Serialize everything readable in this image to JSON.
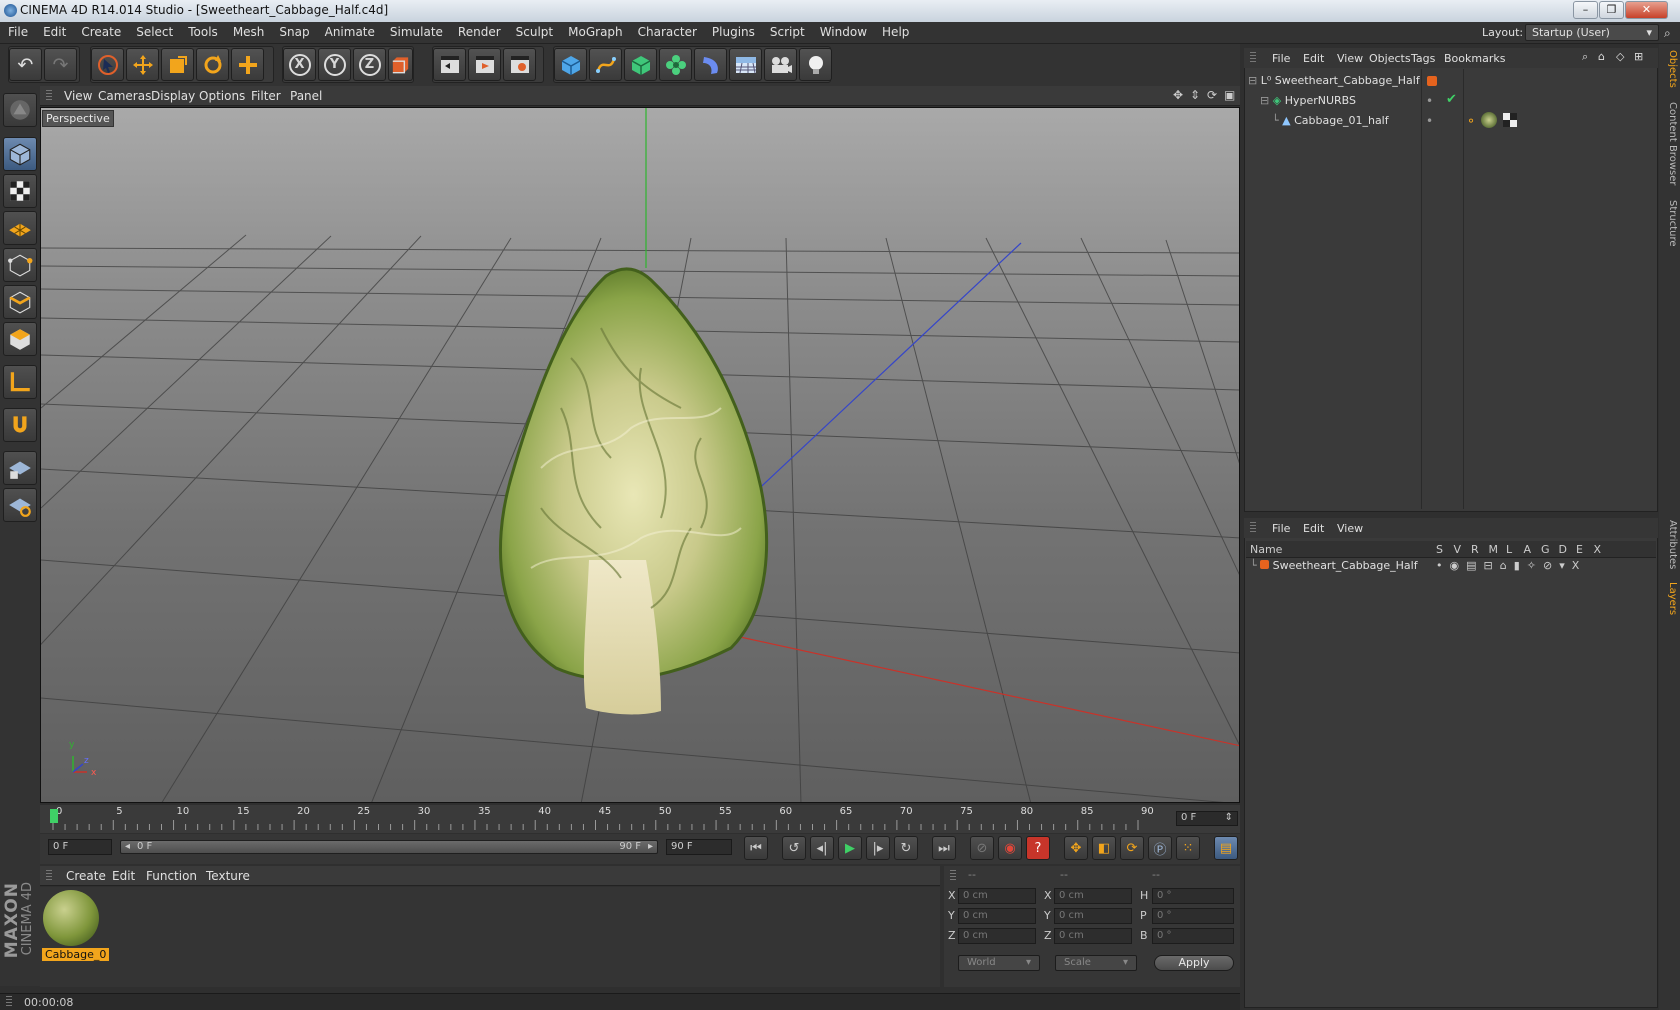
{
  "window": {
    "title": "CINEMA 4D R14.014 Studio - [Sweetheart_Cabbage_Half.c4d]"
  },
  "menu": [
    "File",
    "Edit",
    "Create",
    "Select",
    "Tools",
    "Mesh",
    "Snap",
    "Animate",
    "Simulate",
    "Render",
    "Sculpt",
    "MoGraph",
    "Character",
    "Plugins",
    "Script",
    "Window",
    "Help"
  ],
  "layout": {
    "label": "Layout:",
    "value": "Startup (User)"
  },
  "toolbar": {
    "axis_x": "X",
    "axis_y": "Y",
    "axis_z": "Z"
  },
  "viewport": {
    "menu": [
      "View",
      "Cameras",
      "Display",
      "Options",
      "Filter",
      "Panel"
    ],
    "label": "Perspective",
    "axis_y": "y",
    "axis_z": "z",
    "axis_x": "x"
  },
  "timeline": {
    "ticks": [
      "0",
      "5",
      "10",
      "15",
      "20",
      "25",
      "30",
      "35",
      "40",
      "45",
      "50",
      "55",
      "60",
      "65",
      "70",
      "75",
      "80",
      "85",
      "90"
    ],
    "current": "0 F"
  },
  "playback": {
    "start": "0 F",
    "range_start": "0 F",
    "range_end": "90 F",
    "end": "90 F"
  },
  "materials": {
    "menu": [
      "Create",
      "Edit",
      "Function",
      "Texture"
    ],
    "item": "Cabbage_0"
  },
  "coords": {
    "headers": [
      "--",
      "--",
      "--"
    ],
    "rows": [
      {
        "a": "X",
        "av": "0 cm",
        "b": "X",
        "bv": "0 cm",
        "c": "H",
        "cv": "0 °"
      },
      {
        "a": "Y",
        "av": "0 cm",
        "b": "Y",
        "bv": "0 cm",
        "c": "P",
        "cv": "0 °"
      },
      {
        "a": "Z",
        "av": "0 cm",
        "b": "Z",
        "bv": "0 cm",
        "c": "B",
        "cv": "0 °"
      }
    ],
    "world": "World",
    "scale": "Scale",
    "apply": "Apply"
  },
  "status": {
    "time": "00:00:08"
  },
  "objects": {
    "menu": [
      "File",
      "Edit",
      "View",
      "Objects",
      "Tags",
      "Bookmarks"
    ],
    "items": [
      {
        "name": "Sweetheart_Cabbage_Half"
      },
      {
        "name": "HyperNURBS"
      },
      {
        "name": "Cabbage_01_half"
      }
    ]
  },
  "layers": {
    "menu": [
      "File",
      "Edit",
      "View"
    ],
    "name_header": "Name",
    "cols": [
      "S",
      "V",
      "R",
      "M",
      "L",
      "A",
      "G",
      "D",
      "E",
      "X"
    ],
    "item": "Sweetheart_Cabbage_Half"
  },
  "side_tabs": [
    "Objects",
    "Content Browser",
    "Structure",
    "Attributes",
    "Layers"
  ],
  "branding": {
    "maxon": "MAXON",
    "c4d": "CINEMA 4D"
  },
  "colors": {
    "accent": "#f0a030",
    "layer_orange": "#e5631e",
    "x_axis": "#c8332a",
    "y_axis": "#2fb52f",
    "z_axis": "#3646c8"
  }
}
